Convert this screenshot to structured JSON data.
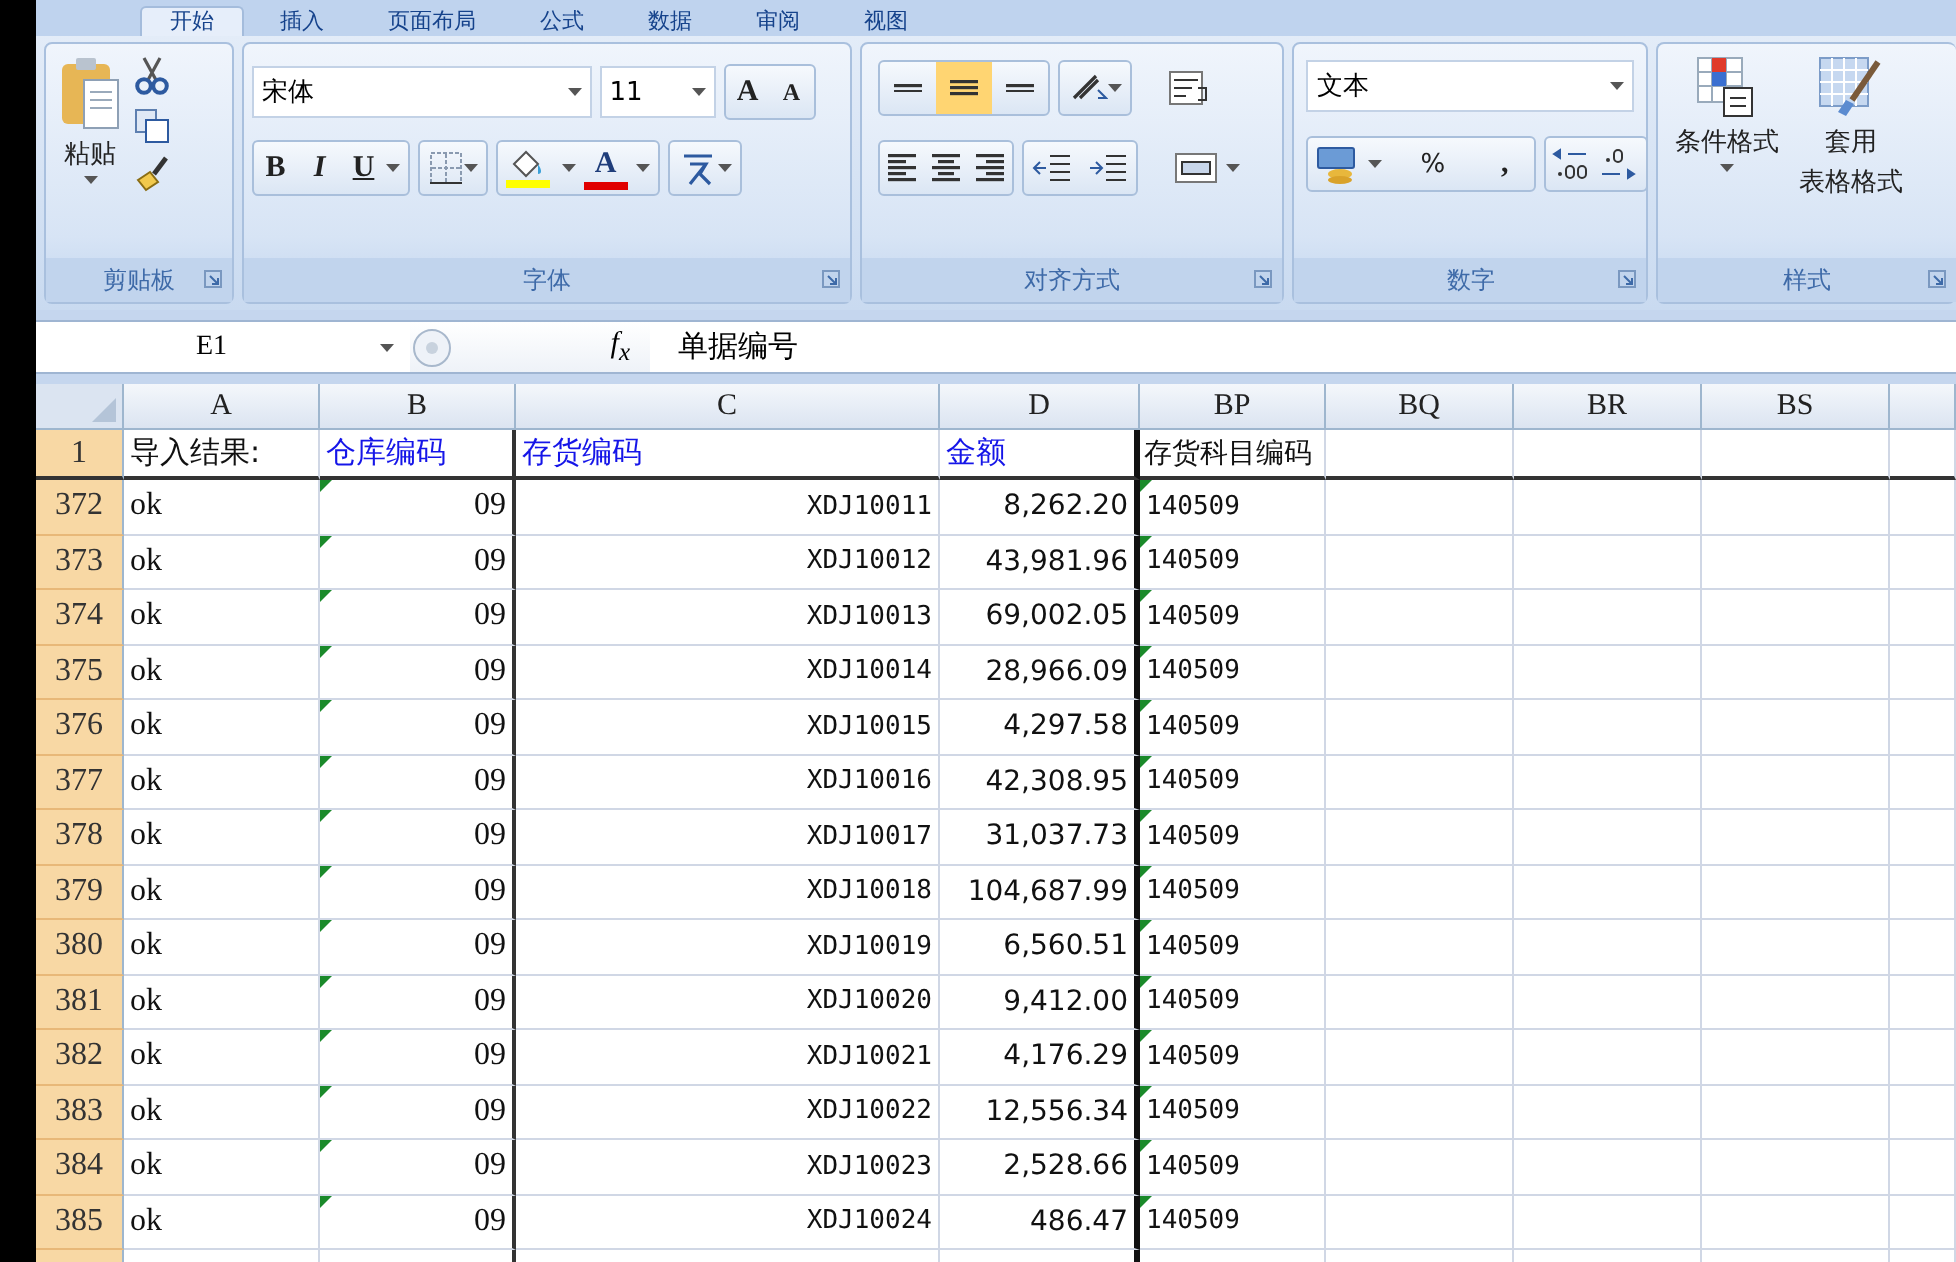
{
  "ribbon_tabs": [
    {
      "label": "开始",
      "selected": true
    },
    {
      "label": "插入",
      "selected": false
    },
    {
      "label": "页面布局",
      "selected": false
    },
    {
      "label": "公式",
      "selected": false
    },
    {
      "label": "数据",
      "selected": false
    },
    {
      "label": "审阅",
      "selected": false
    },
    {
      "label": "视图",
      "selected": false
    }
  ],
  "clipboard": {
    "paste_label": "粘贴",
    "title": "剪贴板"
  },
  "font": {
    "font_name": "宋体",
    "font_size": "11",
    "grow_label": "A",
    "shrink_label": "A",
    "bold_label": "B",
    "italic_label": "I",
    "underline_label": "U",
    "font_color_label": "A",
    "title": "字体"
  },
  "alignment": {
    "vertical": [
      {
        "selected": false
      },
      {
        "selected": true
      },
      {
        "selected": false
      }
    ],
    "title": "对齐方式"
  },
  "number": {
    "format": "文本",
    "percent_label": "%",
    "comma_label": ",",
    "title": "数字"
  },
  "styles": {
    "conditional_label": "条件格式",
    "table_label_lines": [
      "套用",
      "表格格式"
    ],
    "title": "样式"
  },
  "formula_bar": {
    "name_box": "E1",
    "function_label": "f$_{x}$",
    "content": "单据编号"
  },
  "columns": [
    "A",
    "B",
    "C",
    "D",
    "BP",
    "BQ",
    "BR",
    "BS"
  ],
  "header_row": {
    "number": "1",
    "cells": [
      "导入结果:",
      "仓库编码",
      "存货编码",
      "金额",
      "存货科目编码"
    ]
  },
  "rows": [
    {
      "number": "372",
      "cells": [
        "ok",
        "09",
        "XDJ10011",
        "8,262.20",
        "140509"
      ]
    },
    {
      "number": "373",
      "cells": [
        "ok",
        "09",
        "XDJ10012",
        "43,981.96",
        "140509"
      ]
    },
    {
      "number": "374",
      "cells": [
        "ok",
        "09",
        "XDJ10013",
        "69,002.05",
        "140509"
      ]
    },
    {
      "number": "375",
      "cells": [
        "ok",
        "09",
        "XDJ10014",
        "28,966.09",
        "140509"
      ]
    },
    {
      "number": "376",
      "cells": [
        "ok",
        "09",
        "XDJ10015",
        "4,297.58",
        "140509"
      ]
    },
    {
      "number": "377",
      "cells": [
        "ok",
        "09",
        "XDJ10016",
        "42,308.95",
        "140509"
      ]
    },
    {
      "number": "378",
      "cells": [
        "ok",
        "09",
        "XDJ10017",
        "31,037.73",
        "140509"
      ]
    },
    {
      "number": "379",
      "cells": [
        "ok",
        "09",
        "XDJ10018",
        "104,687.99",
        "140509"
      ]
    },
    {
      "number": "380",
      "cells": [
        "ok",
        "09",
        "XDJ10019",
        "6,560.51",
        "140509"
      ]
    },
    {
      "number": "381",
      "cells": [
        "ok",
        "09",
        "XDJ10020",
        "9,412.00",
        "140509"
      ]
    },
    {
      "number": "382",
      "cells": [
        "ok",
        "09",
        "XDJ10021",
        "4,176.29",
        "140509"
      ]
    },
    {
      "number": "383",
      "cells": [
        "ok",
        "09",
        "XDJ10022",
        "12,556.34",
        "140509"
      ]
    },
    {
      "number": "384",
      "cells": [
        "ok",
        "09",
        "XDJ10023",
        "2,528.66",
        "140509"
      ]
    },
    {
      "number": "385",
      "cells": [
        "ok",
        "09",
        "XDJ10024",
        "486.47",
        "140509"
      ]
    }
  ]
}
